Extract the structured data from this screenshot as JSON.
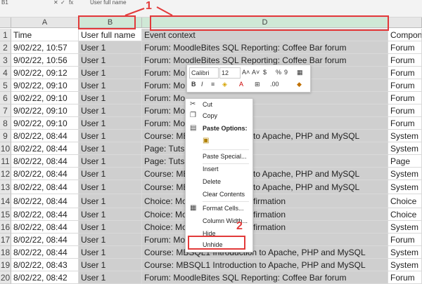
{
  "formula_bar": {
    "name_box": "B1",
    "fx_label": "fx",
    "formula_value": "User full name",
    "cancel_icon": "close-icon",
    "enter_icon": "check-icon"
  },
  "columns": {
    "a": "A",
    "b": "B",
    "d": "D"
  },
  "header_row": {
    "time": "Time",
    "user_full_name": "User full name",
    "event_context": "Event context",
    "component": "Compon"
  },
  "rows": [
    {
      "num": "2",
      "time": "9/02/22, 10:57",
      "user": "User 1",
      "context": "Forum: MoodleBites SQL Reporting: Coffee Bar forum",
      "component": "Forum"
    },
    {
      "num": "3",
      "time": "9/02/22, 10:56",
      "user": "User 1",
      "context": "Forum: MoodleBites SQL Reporting: Coffee Bar forum",
      "component": "Forum"
    },
    {
      "num": "4",
      "time": "9/02/22, 09:12",
      "user": "User 1",
      "context": "Forum: Mo",
      "component": "Forum"
    },
    {
      "num": "5",
      "time": "9/02/22, 09:10",
      "user": "User 1",
      "context": "Forum: Mo",
      "component": "Forum"
    },
    {
      "num": "6",
      "time": "9/02/22, 09:10",
      "user": "User 1",
      "context": "Forum: Mo",
      "component": "Forum"
    },
    {
      "num": "7",
      "time": "9/02/22, 09:10",
      "user": "User 1",
      "context": "Forum: Mo",
      "component": "Forum"
    },
    {
      "num": "8",
      "time": "9/02/22, 09:10",
      "user": "User 1",
      "context": "Forum: Mo",
      "component": "Forum"
    },
    {
      "num": "9",
      "time": "8/02/22, 08:44",
      "user": "User 1",
      "context": "Course: MB",
      "context_tail": "to Apache, PHP and MySQL",
      "component": "System"
    },
    {
      "num": "10",
      "time": "8/02/22, 08:44",
      "user": "User 1",
      "context": "Page: Tuts",
      "component": "System"
    },
    {
      "num": "11",
      "time": "8/02/22, 08:44",
      "user": "User 1",
      "context": "Page: Tuts",
      "component": "Page"
    },
    {
      "num": "12",
      "time": "8/02/22, 08:44",
      "user": "User 1",
      "context": "Course: MB",
      "context_tail": "to Apache, PHP and MySQL",
      "component": "System"
    },
    {
      "num": "13",
      "time": "8/02/22, 08:44",
      "user": "User 1",
      "context": "Course: MB",
      "context_tail": "to Apache, PHP and MySQL",
      "component": "System"
    },
    {
      "num": "14",
      "time": "8/02/22, 08:44",
      "user": "User 1",
      "context": "Choice: Mo",
      "context_tail": "firmation",
      "component": "Choice"
    },
    {
      "num": "15",
      "time": "8/02/22, 08:44",
      "user": "User 1",
      "context": "Choice: Mo",
      "context_tail": "firmation",
      "component": "Choice"
    },
    {
      "num": "16",
      "time": "8/02/22, 08:44",
      "user": "User 1",
      "context": "Choice: Mo",
      "context_tail": "firmation",
      "component": "System"
    },
    {
      "num": "17",
      "time": "8/02/22, 08:44",
      "user": "User 1",
      "context": "Forum: Mo",
      "component": "Forum"
    },
    {
      "num": "18",
      "time": "8/02/22, 08:44",
      "user": "User 1",
      "context": "Course: MBSQL1 Introduction to Apache, PHP and MySQL",
      "component": "System"
    },
    {
      "num": "19",
      "time": "8/02/22, 08:43",
      "user": "User 1",
      "context": "Course: MBSQL1 Introduction to Apache, PHP and MySQL",
      "component": "System"
    },
    {
      "num": "20",
      "time": "8/02/22, 08:42",
      "user": "User 1",
      "context": "Forum: MoodleBites SQL Reporting: Coffee Bar forum",
      "component": "Forum"
    }
  ],
  "row1_num": "1",
  "annotations": {
    "step1": "1",
    "step2": "2",
    "color": "#e23a3a"
  },
  "mini_toolbar": {
    "font": "Calibri",
    "size": "12",
    "grow": "A˄",
    "shrink": "A˅",
    "currency": "$",
    "percent": "%",
    "comma": "9",
    "bold": "B",
    "italic": "I"
  },
  "context_menu": {
    "cut": "Cut",
    "copy": "Copy",
    "paste_options": "Paste Options:",
    "paste_special": "Paste Special...",
    "insert": "Insert",
    "delete": "Delete",
    "clear_contents": "Clear Contents",
    "format_cells": "Format Cells...",
    "column_width": "Column Width...",
    "hide": "Hide",
    "unhide": "Unhide"
  }
}
